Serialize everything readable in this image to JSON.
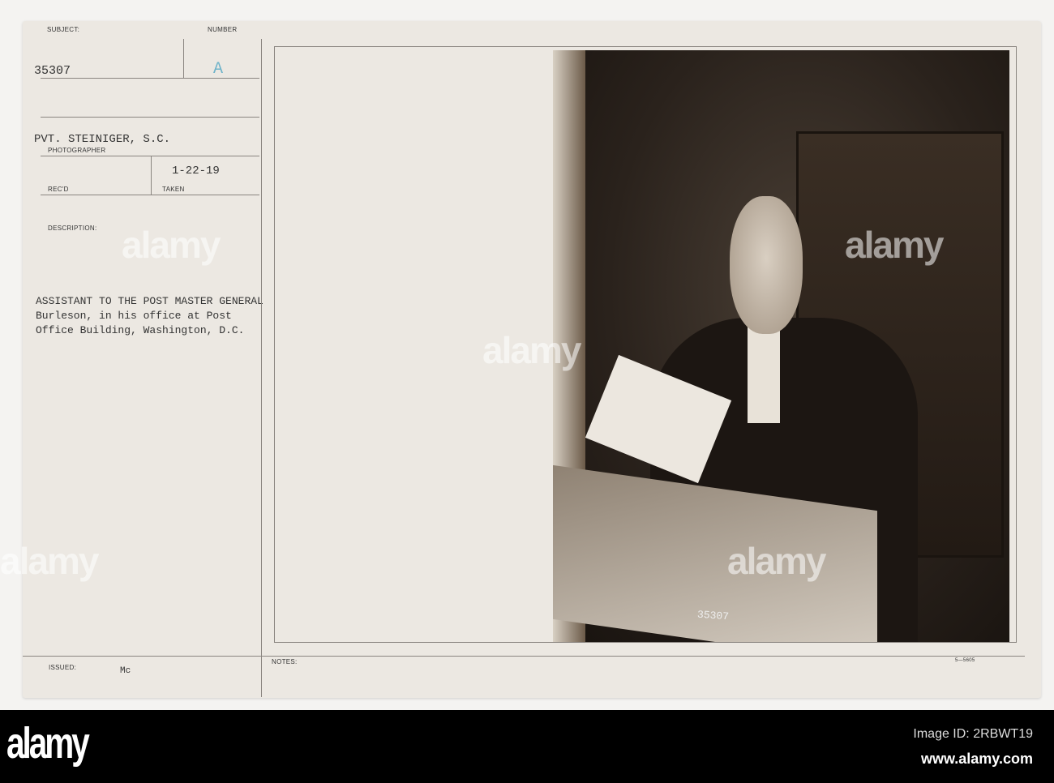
{
  "card": {
    "subject_label": "SUBJECT:",
    "subject_value": "35307",
    "number_label": "NUMBER",
    "number_value": "A",
    "photographer_value": "PVT. STEINIGER, S.C.",
    "photographer_label": "PHOTOGRAPHER",
    "recd_label": "REC'D",
    "taken_value": "1-22-19",
    "taken_label": "TAKEN",
    "description_label": "DESCRIPTION:",
    "description_lines": [
      "ASSISTANT TO THE POST MASTER GENERAL",
      "Burleson, in his office at Post",
      "Office Building, Washington, D.C."
    ],
    "issued_label": "ISSUED:",
    "issued_value": "Mc",
    "notes_label": "NOTES:",
    "form_code": "5—5605",
    "photo_number": "35307"
  },
  "watermark": "alamy",
  "footer": {
    "logo": "alamy",
    "image_id": "Image ID: 2RBWT19",
    "url": "www.alamy.com"
  },
  "colors": {
    "number_stamp": "#6fb3c9"
  }
}
